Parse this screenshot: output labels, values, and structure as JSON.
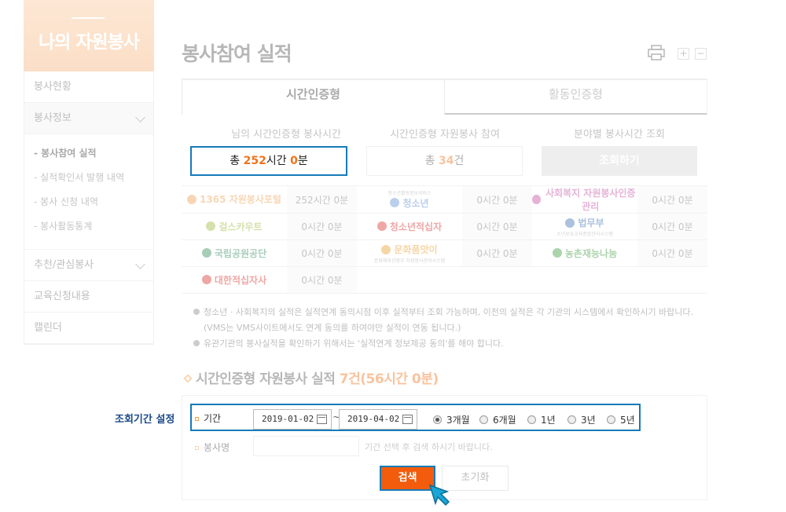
{
  "sidebar": {
    "title": "나의 자원봉사",
    "items": [
      {
        "label": "봉사현황"
      },
      {
        "label": "봉사정보"
      },
      {
        "label": "추천/관심봉사"
      },
      {
        "label": "교육신청내용"
      },
      {
        "label": "캘린더"
      }
    ],
    "sub_items": [
      {
        "label": "- 봉사참여 실적"
      },
      {
        "label": "- 실적확인서 발행 내역"
      },
      {
        "label": "- 봉사 신청 내역"
      },
      {
        "label": "- 봉사활동통계"
      }
    ]
  },
  "page_title": "봉사참여 실적",
  "zoom": {
    "plus": "+",
    "minus": "−"
  },
  "tabs": [
    {
      "label": "시간인증형"
    },
    {
      "label": "활동인증형"
    }
  ],
  "summary": {
    "col1_head": "님의 시간인증형 봉사시간",
    "col1_prefix": "총 ",
    "col1_hours": "252",
    "col1_mid": "시간 ",
    "col1_min": "0",
    "col1_suffix": "분",
    "col2_head": "시간인증형 자원봉사 참여",
    "col2_prefix": "총 ",
    "col2_count": "34",
    "col2_suffix": "건",
    "col3_head": "분야별 봉사시간 조회",
    "col3_button": "조회하기"
  },
  "orgs": [
    [
      {
        "name": "1365 자원봉사포털",
        "value": "252시간 0분",
        "color": "#f0a050"
      },
      {
        "name": "청소년",
        "value": "0시간 0분",
        "color": "#5a8fd0",
        "sub": "청소년활동정보서비스"
      },
      {
        "name": "사회복지 자원봉사인증관리",
        "value": "0시간 0분",
        "color": "#c24aa0"
      }
    ],
    [
      {
        "name": "걸스카우트",
        "value": "0시간 0분",
        "color": "#9bb83a"
      },
      {
        "name": "청소년적십자",
        "value": "0시간 0분",
        "color": "#d9302c"
      },
      {
        "name": "법무부",
        "value": "0시간 0분",
        "color": "#3a6db0",
        "sub": "소년보호교육종합관리시스템"
      }
    ],
    [
      {
        "name": "국립공원공단",
        "value": "0시간 0분",
        "color": "#2f8a5a"
      },
      {
        "name": "문화품앗이",
        "value": "0시간 0분",
        "color": "#e8a02a",
        "sub": "문화체육관광부 자원봉사관리시스템"
      },
      {
        "name": "농촌재능나눔",
        "value": "0시간 0분",
        "color": "#3a9a3a"
      }
    ],
    [
      {
        "name": "대한적십자사",
        "value": "0시간 0분",
        "color": "#d9302c"
      }
    ]
  ],
  "notes": [
    "청소년 · 사회복지의 실적은 실적연계 동의시점 이후 실적부터 조회 가능하며, 이전의 실적은 각 기관의 시스템에서 확인하시기 바랍니다.",
    "(VMS는 VMS사이트에서도 연계 동의를 하여야만 실적이 연동 됩니다.)",
    "유관기관의 봉사실적을 확인하기 위해서는 '실적연계 정보제공 동의'를 해야 합니다."
  ],
  "section": {
    "title": "시간인증형 자원봉사 실적 ",
    "count": "7건(56시간 0분)"
  },
  "search": {
    "outside_label": "조회기간 설정",
    "period_label": "기간",
    "date_from": "2019-01-02",
    "date_to": "2019-04-02",
    "tilde": "~",
    "options": [
      {
        "label": "3개월",
        "selected": true
      },
      {
        "label": "6개월",
        "selected": false
      },
      {
        "label": "1년",
        "selected": false
      },
      {
        "label": "3년",
        "selected": false
      },
      {
        "label": "5년",
        "selected": false
      }
    ],
    "name_label": "봉사명",
    "name_value": "",
    "name_hint": "기간 선택 후 검색 하시기 바랍니다.",
    "search_button": "검색",
    "reset_button": "초기화"
  },
  "colors": {
    "accent": "#f25c0c",
    "highlight_border": "#167ab8",
    "sidebar_head": "#f7b27a"
  }
}
